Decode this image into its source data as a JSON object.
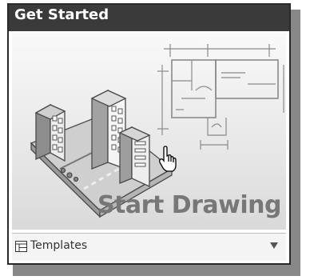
{
  "panel": {
    "title": "Get Started",
    "start_drawing_label": "Start Drawing",
    "templates_label": "Templates"
  },
  "icons": {
    "header": "none",
    "templates": "template-grid-icon",
    "dropdown": "chevron-down-icon",
    "cursor": "hand-pointer-icon"
  }
}
